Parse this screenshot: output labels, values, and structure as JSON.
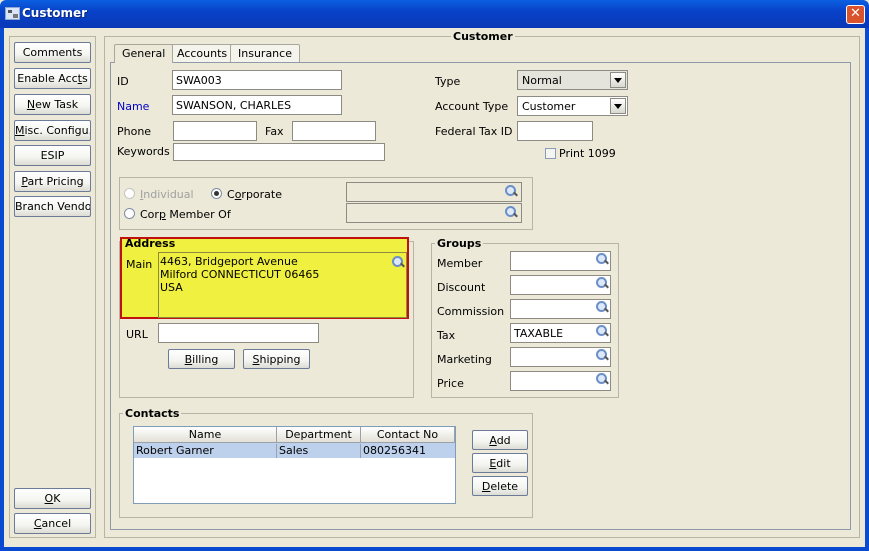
{
  "window": {
    "title": "Customer",
    "close_symbol": "✕"
  },
  "side_buttons": {
    "comments": "Comments",
    "enable_accts": {
      "pre": "Enable Acc",
      "u": "t",
      "post": "s"
    },
    "new_task": {
      "pre": "",
      "u": "N",
      "post": "ew Task"
    },
    "misc_config": {
      "pre": "",
      "u": "M",
      "post": "isc. Configu..."
    },
    "esip": "ESIP",
    "part_pricing": {
      "pre": "",
      "u": "P",
      "post": "art Pricing"
    },
    "branch_vendor": "Branch Vendor",
    "ok": {
      "pre": "",
      "u": "O",
      "post": "K"
    },
    "cancel": {
      "pre": "",
      "u": "C",
      "post": "ancel"
    }
  },
  "panel_title": "Customer",
  "tabs": [
    {
      "label": "General"
    },
    {
      "label": "Accounts"
    },
    {
      "label": "Insurance"
    }
  ],
  "general": {
    "id_label": "ID",
    "id_value": "SWA003",
    "name_label": "Name",
    "name_value": "SWANSON, CHARLES",
    "phone_label": "Phone",
    "phone_value": "",
    "fax_label": "Fax",
    "fax_value": "",
    "keywords_label": "Keywords",
    "keywords_value": "",
    "type_label": "Type",
    "type_value": "Normal",
    "account_type_label": "Account Type",
    "account_type_value": "Customer",
    "federal_tax_label": "Federal Tax ID",
    "federal_tax_value": "",
    "print1099_label": "Print 1099",
    "print1099_checked": false
  },
  "entity": {
    "individual": {
      "pre": "",
      "u": "I",
      "post": "ndividual"
    },
    "corporate": {
      "pre": "C",
      "u": "o",
      "post": "rporate"
    },
    "corp_member": {
      "pre": "Cor",
      "u": "p",
      "post": " Member Of"
    },
    "selected": "corporate"
  },
  "address": {
    "legend": "Address",
    "main_label": "Main",
    "lines": [
      "4463, Bridgeport Avenue",
      "Milford CONNECTICUT 06465",
      "USA"
    ],
    "url_label": "URL",
    "url_value": "",
    "billing": {
      "pre": "",
      "u": "B",
      "post": "illing"
    },
    "shipping": {
      "pre": "",
      "u": "S",
      "post": "hipping"
    },
    "highlight_color": "#f0f040",
    "border_color": "#c01010"
  },
  "groups": {
    "legend": "Groups",
    "rows": [
      {
        "label": "Member",
        "value": ""
      },
      {
        "label": "Discount",
        "value": ""
      },
      {
        "label": "Commission",
        "value": ""
      },
      {
        "label": "Tax",
        "value": "TAXABLE"
      },
      {
        "label": "Marketing",
        "value": ""
      },
      {
        "label": "Price",
        "value": ""
      }
    ]
  },
  "contacts": {
    "legend": "Contacts",
    "columns": [
      "Name",
      "Department",
      "Contact No"
    ],
    "rows": [
      {
        "name": "Robert Garner",
        "department": "Sales",
        "contact_no": "080256341"
      }
    ],
    "add": {
      "pre": "",
      "u": "A",
      "post": "dd"
    },
    "edit": {
      "pre": "",
      "u": "E",
      "post": "dit"
    },
    "delete": {
      "pre": "",
      "u": "D",
      "post": "elete"
    }
  },
  "colors": {
    "name_label": "#0000c8",
    "selected_row": "#bdd0ec"
  },
  "icons": [
    "app-icon",
    "close-icon",
    "magnifier-icon",
    "dropdown-arrow-icon"
  ]
}
